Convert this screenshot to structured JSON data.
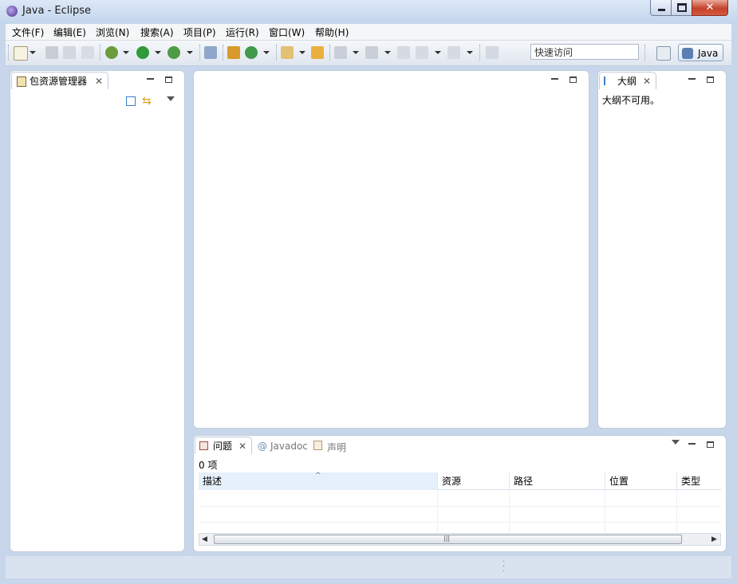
{
  "window": {
    "title": "Java  -  Eclipse"
  },
  "menu": {
    "items": [
      "文件(F)",
      "编辑(E)",
      "浏览(N)",
      "搜索(A)",
      "项目(P)",
      "运行(R)",
      "窗口(W)",
      "帮助(H)"
    ]
  },
  "toolbar": {
    "quick_access_placeholder": "快速访问",
    "perspective_label": "Java"
  },
  "package_explorer": {
    "tab_label": "包资源管理器"
  },
  "outline": {
    "tab_label": "大纲",
    "empty_message": "大纲不可用。"
  },
  "bottom_panel": {
    "tabs": [
      "问题",
      "Javadoc",
      "声明"
    ],
    "count_label": "0 项",
    "columns": [
      "描述",
      "资源",
      "路径",
      "位置",
      "类型"
    ]
  },
  "colors": {
    "frame": "#c7d6ea",
    "accent": "#3c7fc9"
  }
}
